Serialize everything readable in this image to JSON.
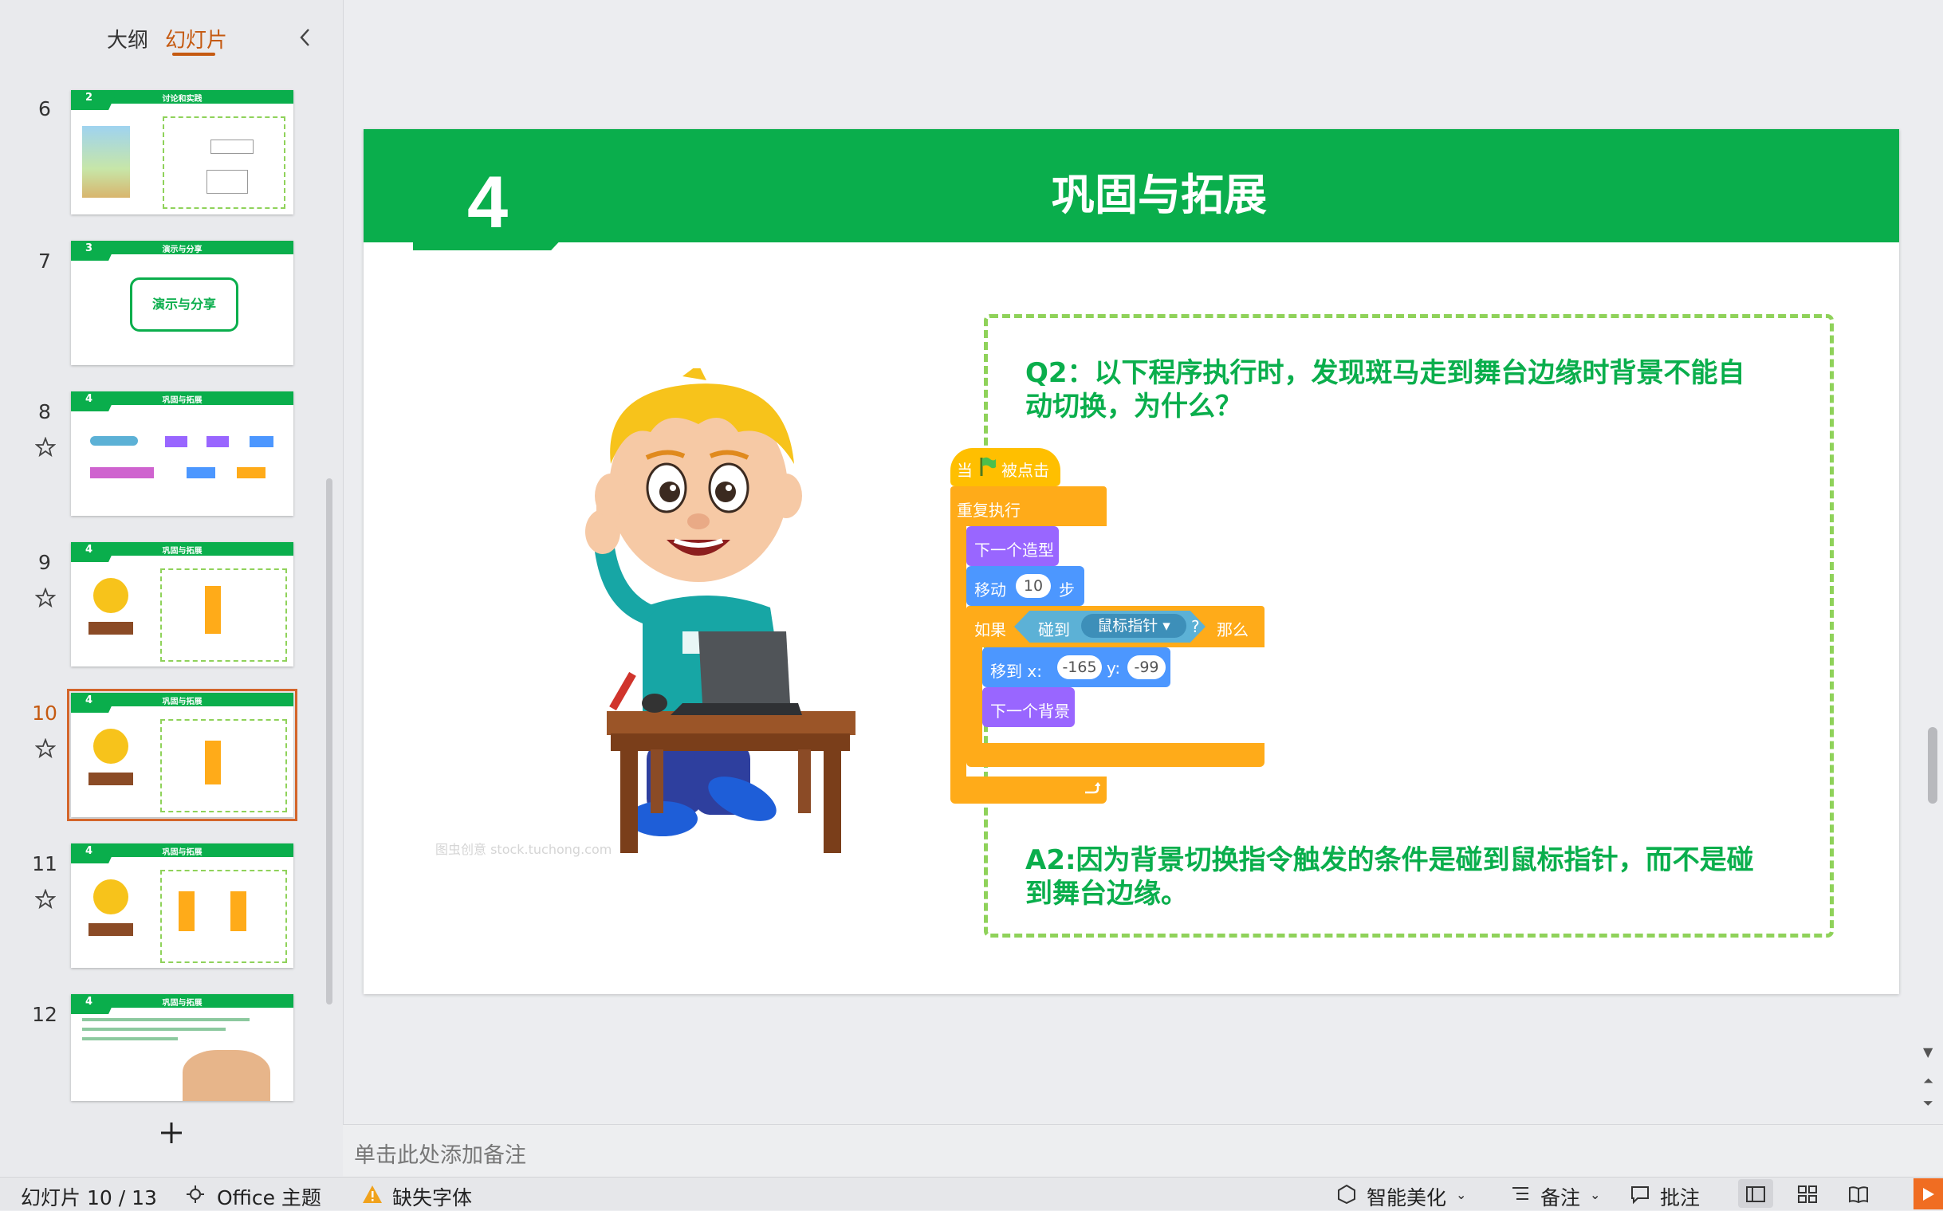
{
  "left_panel": {
    "tabs": [
      {
        "label": "大纲",
        "active": false
      },
      {
        "label": "幻灯片",
        "active": true
      }
    ],
    "thumbnails": [
      {
        "number": "6",
        "tag": "2",
        "title": "讨论和实践",
        "starred": false,
        "selected": false
      },
      {
        "number": "7",
        "tag": "3",
        "title": "演示与分享",
        "body": "演示与分享",
        "starred": false,
        "selected": false
      },
      {
        "number": "8",
        "tag": "4",
        "title": "巩固与拓展",
        "starred": true,
        "selected": false
      },
      {
        "number": "9",
        "tag": "4",
        "title": "巩固与拓展",
        "starred": true,
        "selected": false
      },
      {
        "number": "10",
        "tag": "4",
        "title": "巩固与拓展",
        "starred": true,
        "selected": true
      },
      {
        "number": "11",
        "tag": "4",
        "title": "巩固与拓展",
        "starred": true,
        "selected": false
      },
      {
        "number": "12",
        "tag": "4",
        "title": "巩固与拓展",
        "starred": false,
        "selected": false
      }
    ]
  },
  "slide": {
    "number": "4",
    "title": "巩固与拓展",
    "question": "Q2：以下程序执行时，发现斑马走到舞台边缘时背景不能自动切换，为什么？",
    "answer": "A2:因为背景切换指令触发的条件是碰到鼠标指针，而不是碰到舞台边缘。",
    "watermark": "图虫创意 stock.tuchong.com",
    "scratch": {
      "when_clicked": {
        "prefix": "当",
        "suffix": "被点击"
      },
      "forever": "重复执行",
      "next_costume": "下一个造型",
      "move": {
        "label": "移动",
        "value": "10",
        "unit": "步"
      },
      "if_block": {
        "if": "如果",
        "touching": "碰到",
        "target": "鼠标指针",
        "q": "?",
        "then": "那么"
      },
      "goto": {
        "label": "移到 x:",
        "x": "-165",
        "y_label": "y:",
        "y": "-99"
      },
      "next_backdrop": "下一个背景"
    }
  },
  "notes": {
    "placeholder": "单击此处添加备注"
  },
  "status_bar": {
    "slide_info": "幻灯片 10 / 13",
    "theme": "Office 主题",
    "missing_font": "缺失字体",
    "smart_beautify": "智能美化",
    "notes_btn": "备注",
    "comments_btn": "批注"
  },
  "colors": {
    "accent_green": "#0aae4c",
    "dash_green": "#8fd25a",
    "selection_orange": "#d4652a",
    "scratch_events": "#ffbf00",
    "scratch_control": "#ffab19",
    "scratch_looks": "#9966ff",
    "scratch_motion": "#4c97ff",
    "scratch_sensing": "#5cb1d6"
  }
}
